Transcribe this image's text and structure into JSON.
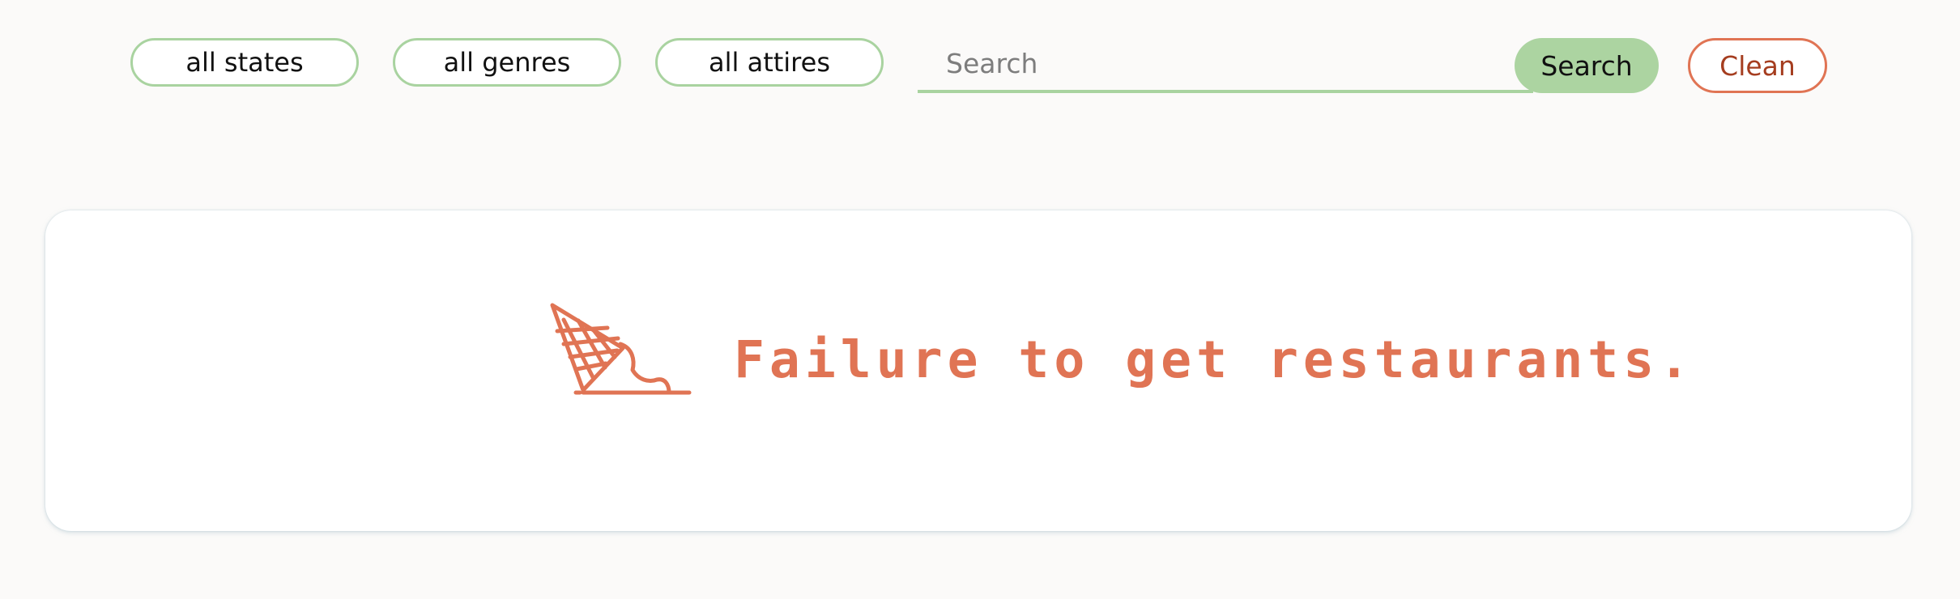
{
  "filters": [
    {
      "label": "all states"
    },
    {
      "label": "all genres"
    },
    {
      "label": "all attires"
    }
  ],
  "search": {
    "placeholder": "Search",
    "value": "",
    "button_label": "Search"
  },
  "clean_button": {
    "label": "Clean"
  },
  "message": {
    "text": "Failure to get restaurants.",
    "icon": "dropped-ice-cream-cone-icon"
  },
  "colors": {
    "accent_green": "#a9d3a0",
    "accent_orange": "#e07454",
    "clean_text": "#a53d1f",
    "background": "#fbfaf9"
  }
}
